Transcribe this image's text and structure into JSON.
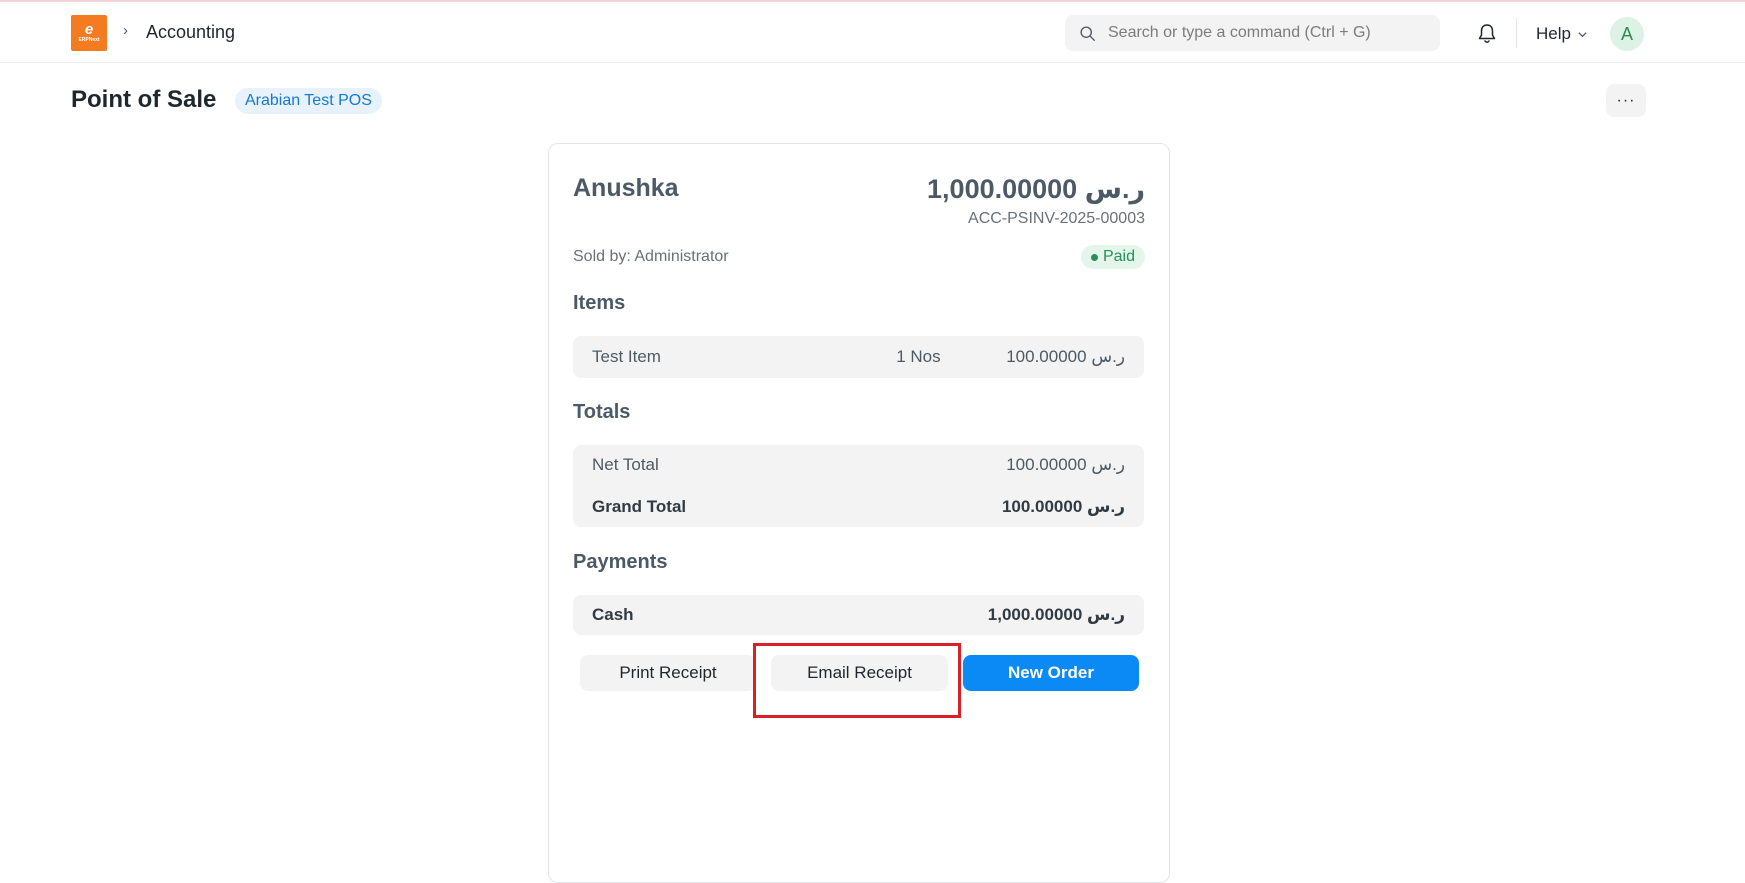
{
  "navbar": {
    "logo_text": "ERPNext",
    "breadcrumb": "Accounting",
    "search_placeholder": "Search or type a command (Ctrl + G)",
    "help_label": "Help",
    "avatar_initial": "A"
  },
  "page": {
    "title": "Point of Sale",
    "pos_profile": "Arabian Test POS",
    "more_label": "···"
  },
  "invoice": {
    "customer": "Anushka",
    "amount": "1,000.00000 ر.س",
    "number": "ACC-PSINV-2025-00003",
    "sold_by": "Sold by: Administrator",
    "status": "Paid",
    "items_heading": "Items",
    "items": [
      {
        "name": "Test Item",
        "qty": "1 Nos",
        "rate": "100.00000 ر.س"
      }
    ],
    "totals_heading": "Totals",
    "net_total_label": "Net Total",
    "net_total_value": "100.00000 ر.س",
    "grand_total_label": "Grand Total",
    "grand_total_value": "100.00000 ر.س",
    "payments_heading": "Payments",
    "payments": [
      {
        "mode": "Cash",
        "amount": "1,000.00000 ر.س"
      }
    ]
  },
  "actions": {
    "print_label": "Print Receipt",
    "email_label": "Email Receipt",
    "new_order_label": "New Order"
  },
  "colors": {
    "primary": "#0b8af5",
    "logo": "#f47b20",
    "paid": "#278f5e",
    "highlight": "#d92027"
  }
}
